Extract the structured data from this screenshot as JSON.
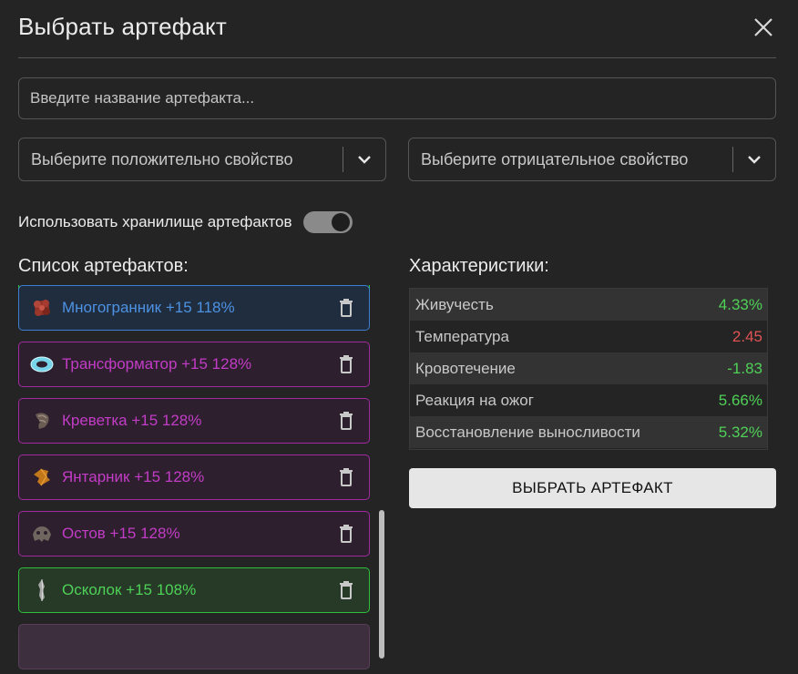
{
  "dialog": {
    "title": "Выбрать артефакт",
    "close_icon": "close-icon"
  },
  "search": {
    "placeholder": "Введите название артефакта..."
  },
  "filters": {
    "positive_placeholder": "Выберите положительно свойство",
    "negative_placeholder": "Выберите отрицательное свойство",
    "dropdown_icon": "chevron-down-icon"
  },
  "storage_toggle": {
    "label": "Использовать хранилище артефактов",
    "enabled": true
  },
  "artifacts": {
    "label": "Список артефактов:",
    "items": [
      {
        "name": "",
        "rarity": "green",
        "icon": "artifact-icon"
      },
      {
        "name": "Многогранник +15 118%",
        "rarity": "blue",
        "icon": "crystal-cluster-icon",
        "color": "#4d92e3"
      },
      {
        "name": "Трансформатор +15 128%",
        "rarity": "purple",
        "icon": "glowing-ring-icon",
        "color": "#c23cc5"
      },
      {
        "name": "Креветка +15 128%",
        "rarity": "purple",
        "icon": "shrimp-icon",
        "color": "#c23cc5"
      },
      {
        "name": "Янтарник +15 128%",
        "rarity": "purple",
        "icon": "amber-icon",
        "color": "#c23cc5"
      },
      {
        "name": "Остов +15 128%",
        "rarity": "purple",
        "icon": "skeleton-icon",
        "color": "#c23cc5"
      },
      {
        "name": "Осколок +15 108%",
        "rarity": "green",
        "icon": "shard-icon",
        "color": "#4fd157"
      },
      {
        "name": "",
        "rarity": "grayc",
        "icon": "artifact-icon"
      }
    ],
    "delete_icon": "trash-icon"
  },
  "stats": {
    "label": "Характеристики:",
    "rows": [
      {
        "name": "Живучесть",
        "value": "4.33%",
        "sign": "pos"
      },
      {
        "name": "Температура",
        "value": "2.45",
        "sign": "neg"
      },
      {
        "name": "Кровотечение",
        "value": "-1.83",
        "sign": "pos"
      },
      {
        "name": "Реакция на ожог",
        "value": "5.66%",
        "sign": "pos"
      },
      {
        "name": "Восстановление выносливости",
        "value": "5.32%",
        "sign": "pos"
      }
    ]
  },
  "actions": {
    "choose_label": "ВЫБРАТЬ АРТЕФАКТ"
  },
  "colors": {
    "positive": "#4fd157",
    "negative": "#e05353",
    "background": "#242424"
  }
}
